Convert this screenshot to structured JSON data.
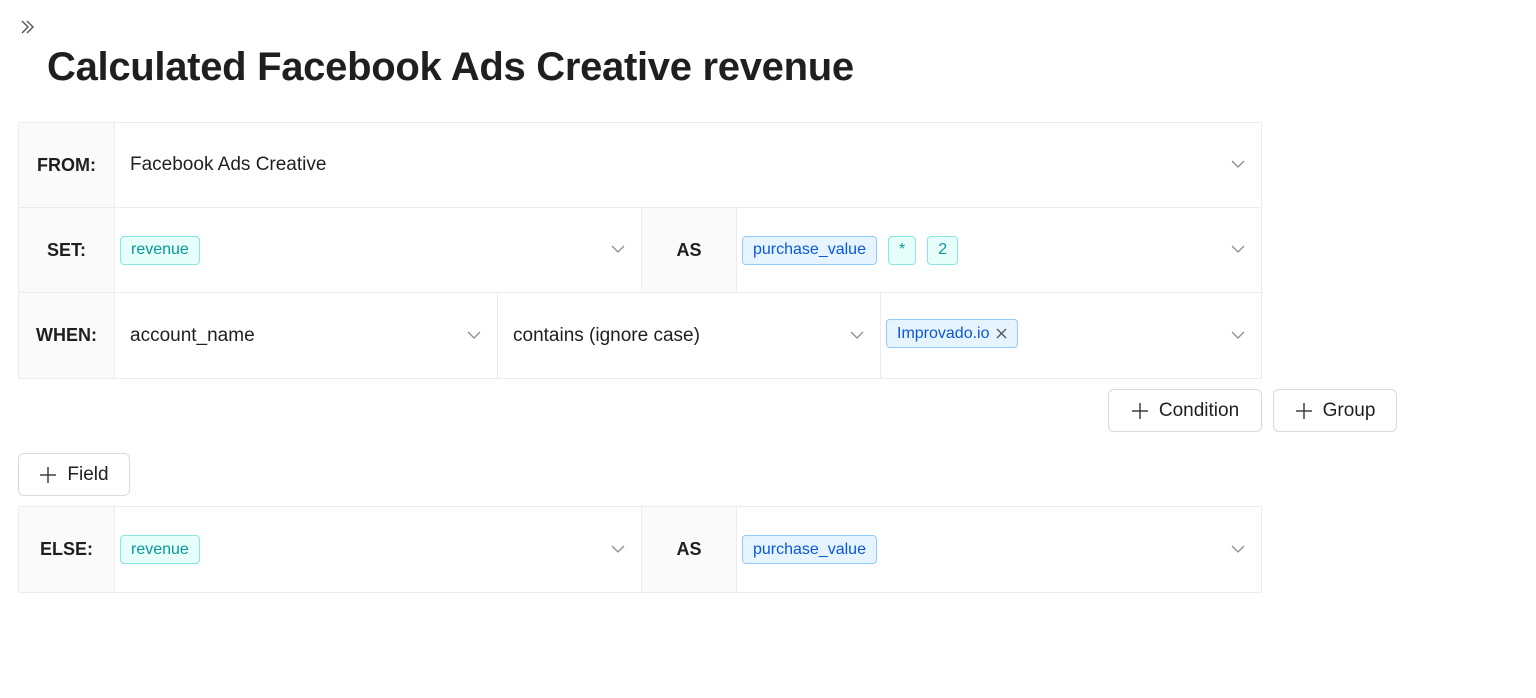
{
  "page": {
    "title": "Calculated Facebook Ads Creative revenue"
  },
  "from": {
    "keyword": "FROM:",
    "value": "Facebook Ads Creative"
  },
  "set": {
    "keyword": "SET:",
    "field_tag": "revenue",
    "as_keyword": "AS",
    "expression": [
      "purchase_value",
      "*",
      "2"
    ]
  },
  "when": {
    "keyword": "WHEN:",
    "field": "account_name",
    "operator": "contains (ignore case)",
    "value_tag": "Improvado.io"
  },
  "buttons": {
    "add_condition": "Condition",
    "add_group": "Group",
    "add_field": "Field"
  },
  "else": {
    "keyword": "ELSE:",
    "field_tag": "revenue",
    "as_keyword": "AS",
    "expression": [
      "purchase_value"
    ]
  },
  "colors": {
    "field_tag_bg": "#e6fffb",
    "field_tag_text": "#08979c",
    "value_tag_bg": "#e6f4ff",
    "value_tag_text": "#0958d9"
  },
  "icons": {
    "expand": "double-chevron-right-icon",
    "dropdown": "chevron-down-icon",
    "remove": "close-icon",
    "add": "plus-icon"
  }
}
